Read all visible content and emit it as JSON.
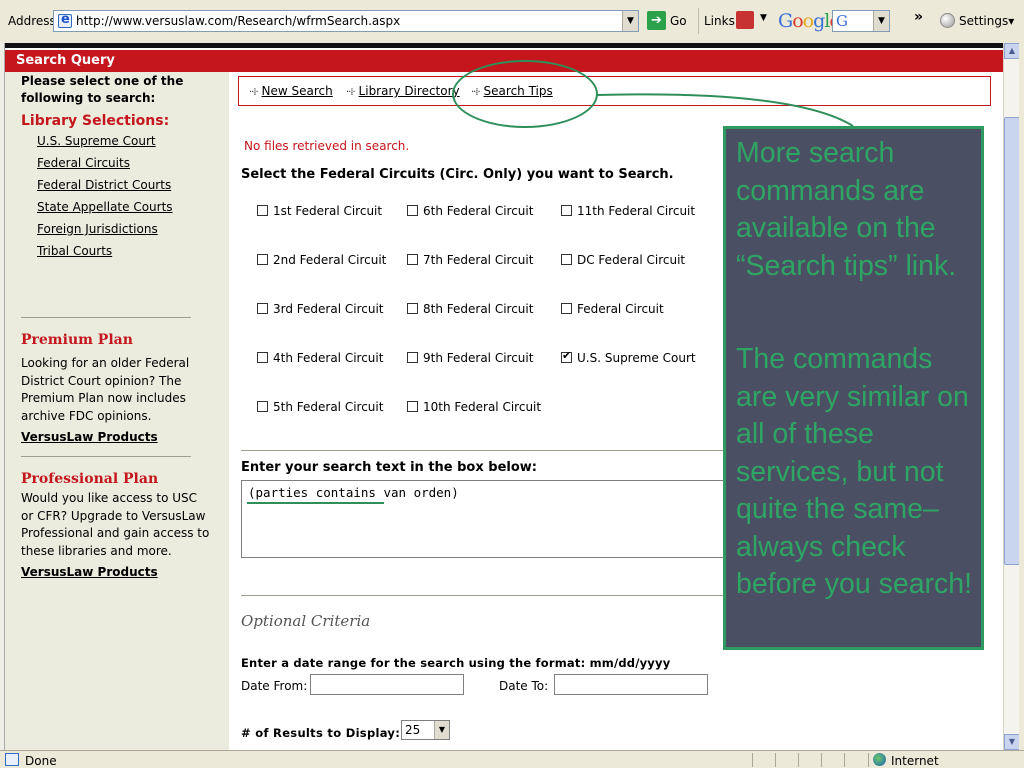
{
  "browser": {
    "address_label": "Address",
    "url": "http://www.versuslaw.com/Research/wfrmSearch.aspx",
    "go_label": "Go",
    "links_label": "Links",
    "google_logo": "Google",
    "google_box_letter": "G",
    "chevrons": "»",
    "settings_label": "Settings▾"
  },
  "header": {
    "title": "Search Query"
  },
  "sidebar": {
    "prompt": "Please select one of the following to search:",
    "library_heading": "Library Selections:",
    "library_links": [
      "U.S. Supreme Court",
      "Federal Circuits",
      "Federal District Courts",
      "State Appellate Courts",
      "Foreign Jurisdictions",
      "Tribal Courts"
    ],
    "premium": {
      "heading": "Premium Plan",
      "text": "Looking for an older Federal District Court opinion? The Premium Plan now includes archive FDC opinions.",
      "link": "VersusLaw Products"
    },
    "professional": {
      "heading": "Professional Plan",
      "text": "Would you like access to USC or CFR? Upgrade to VersusLaw Professional and gain access to these libraries and more.",
      "link": "VersusLaw Products"
    }
  },
  "nav": {
    "icon": "··⁞·",
    "items": [
      "New Search",
      "Library Directory",
      "Search Tips"
    ]
  },
  "main": {
    "no_files": "No files retrieved in search.",
    "circuit_prompt": "Select the Federal Circuits (Circ. Only) you want to Search.",
    "circuits": [
      {
        "label": "1st Federal Circuit",
        "checked": false
      },
      {
        "label": "6th Federal Circuit",
        "checked": false
      },
      {
        "label": "11th Federal Circuit",
        "checked": false
      },
      {
        "label": "2nd Federal Circuit",
        "checked": false
      },
      {
        "label": "7th Federal Circuit",
        "checked": false
      },
      {
        "label": "DC Federal Circuit",
        "checked": false
      },
      {
        "label": "3rd Federal Circuit",
        "checked": false
      },
      {
        "label": "8th Federal Circuit",
        "checked": false
      },
      {
        "label": "Federal Circuit",
        "checked": false
      },
      {
        "label": "4th Federal Circuit",
        "checked": false
      },
      {
        "label": "9th Federal Circuit",
        "checked": false
      },
      {
        "label": "U.S. Supreme Court",
        "checked": true
      },
      {
        "label": "5th Federal Circuit",
        "checked": false
      },
      {
        "label": "10th Federal Circuit",
        "checked": false
      }
    ],
    "search_prompt": "Enter your search text in the box below:",
    "search_value": "(parties contains van orden)",
    "optional_heading": "Optional Criteria",
    "date_prompt": "Enter a date range for the search using the format: mm/dd/yyyy",
    "date_from_label": "Date From:",
    "date_to_label": "Date To:",
    "results_label": "# of Results to Display:",
    "results_value": "25"
  },
  "callout": {
    "paragraph1": "More search commands are available on the “Search tips” link.",
    "paragraph2": "The commands are very similar on all of these services, but not quite the same–always check before you search!",
    "color": "#2fa564",
    "background": "#4b4f63"
  },
  "status": {
    "text": "Done",
    "zone": "Internet"
  }
}
